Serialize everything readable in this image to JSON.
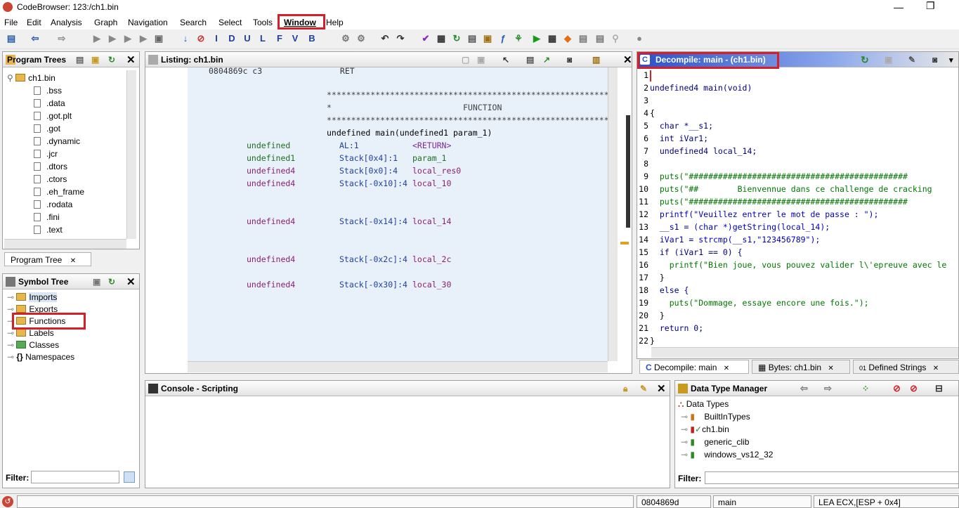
{
  "window": {
    "title": "CodeBrowser: 123:/ch1.bin",
    "minimize": "—",
    "maximize": "❐"
  },
  "menu": [
    "File",
    "Edit",
    "Analysis",
    "Graph",
    "Navigation",
    "Search",
    "Select",
    "Tools",
    "Window",
    "Help"
  ],
  "program_trees": {
    "title": "Program Trees",
    "root": "ch1.bin",
    "items": [
      ".bss",
      ".data",
      ".got.plt",
      ".got",
      ".dynamic",
      ".jcr",
      ".dtors",
      ".ctors",
      ".eh_frame",
      ".rodata",
      ".fini",
      ".text"
    ],
    "tab": "Program Tree"
  },
  "symbol_tree": {
    "title": "Symbol Tree",
    "items": [
      "Imports",
      "Exports",
      "Functions",
      "Labels",
      "Classes",
      "Namespaces"
    ],
    "filter_label": "Filter:"
  },
  "listing": {
    "title": "Listing:  ch1.bin",
    "top_line": "0804869c c3                RET",
    "stars": "************************************************************",
    "function_label": "FUNCTION",
    "signature": "undefined main(undefined1 param_1)",
    "vars": [
      {
        "type": "undefined",
        "loc": "AL:1",
        "name": "<RETURN>"
      },
      {
        "type": "undefined1",
        "loc": "Stack[0x4]:1",
        "name": "param_1"
      },
      {
        "type": "undefined4",
        "loc": "Stack[0x0]:4",
        "name": "local_res0"
      },
      {
        "type": "undefined4",
        "loc": "Stack[-0x10]:4",
        "name": "local_10"
      },
      {
        "type": "undefined4",
        "loc": "Stack[-0x14]:4",
        "name": "local_14"
      },
      {
        "type": "undefined4",
        "loc": "Stack[-0x2c]:4",
        "name": "local_2c"
      },
      {
        "type": "undefined4",
        "loc": "Stack[-0x30]:4",
        "name": "local_30"
      }
    ]
  },
  "decompile": {
    "title": "Decompile: main -  (ch1.bin)",
    "lines": [
      {
        "n": "1",
        "t": ""
      },
      {
        "n": "2",
        "t": "undefined4 main(void)"
      },
      {
        "n": "3",
        "t": ""
      },
      {
        "n": "4",
        "t": "{"
      },
      {
        "n": "5",
        "t": "  char *__s1;"
      },
      {
        "n": "6",
        "t": "  int iVar1;"
      },
      {
        "n": "7",
        "t": "  undefined4 local_14;"
      },
      {
        "n": "8",
        "t": ""
      },
      {
        "n": "9",
        "t": "  puts(\"#############################################"
      },
      {
        "n": "10",
        "t": "  puts(\"##        Bienvennue dans ce challenge de cracking"
      },
      {
        "n": "11",
        "t": "  puts(\"#############################################"
      },
      {
        "n": "12",
        "t": "  printf(\"Veuillez entrer le mot de passe : \");"
      },
      {
        "n": "13",
        "t": "  __s1 = (char *)getString(local_14);"
      },
      {
        "n": "14",
        "t": "  iVar1 = strcmp(__s1,\"123456789\");"
      },
      {
        "n": "15",
        "t": "  if (iVar1 == 0) {"
      },
      {
        "n": "16",
        "t": "    printf(\"Bien joue, vous pouvez valider l\\'epreuve avec le"
      },
      {
        "n": "17",
        "t": "  }"
      },
      {
        "n": "18",
        "t": "  else {"
      },
      {
        "n": "19",
        "t": "    puts(\"Dommage, essaye encore une fois.\");"
      },
      {
        "n": "20",
        "t": "  }"
      },
      {
        "n": "21",
        "t": "  return 0;"
      },
      {
        "n": "22",
        "t": "}"
      }
    ],
    "tabs": [
      "Decompile: main",
      "Bytes: ch1.bin",
      "Defined Strings"
    ]
  },
  "console": {
    "title": "Console - Scripting"
  },
  "dtm": {
    "title": "Data Type Manager",
    "root": "Data Types",
    "items": [
      "BuiltInTypes",
      "ch1.bin",
      "generic_clib",
      "windows_vs12_32"
    ],
    "filter_label": "Filter:"
  },
  "status": {
    "address": "0804869d",
    "function": "main",
    "instruction": "LEA ECX,[ESP + 0x4]"
  },
  "colors": {
    "highlight": "#d42028",
    "listing_bg": "#e8f0fa"
  }
}
